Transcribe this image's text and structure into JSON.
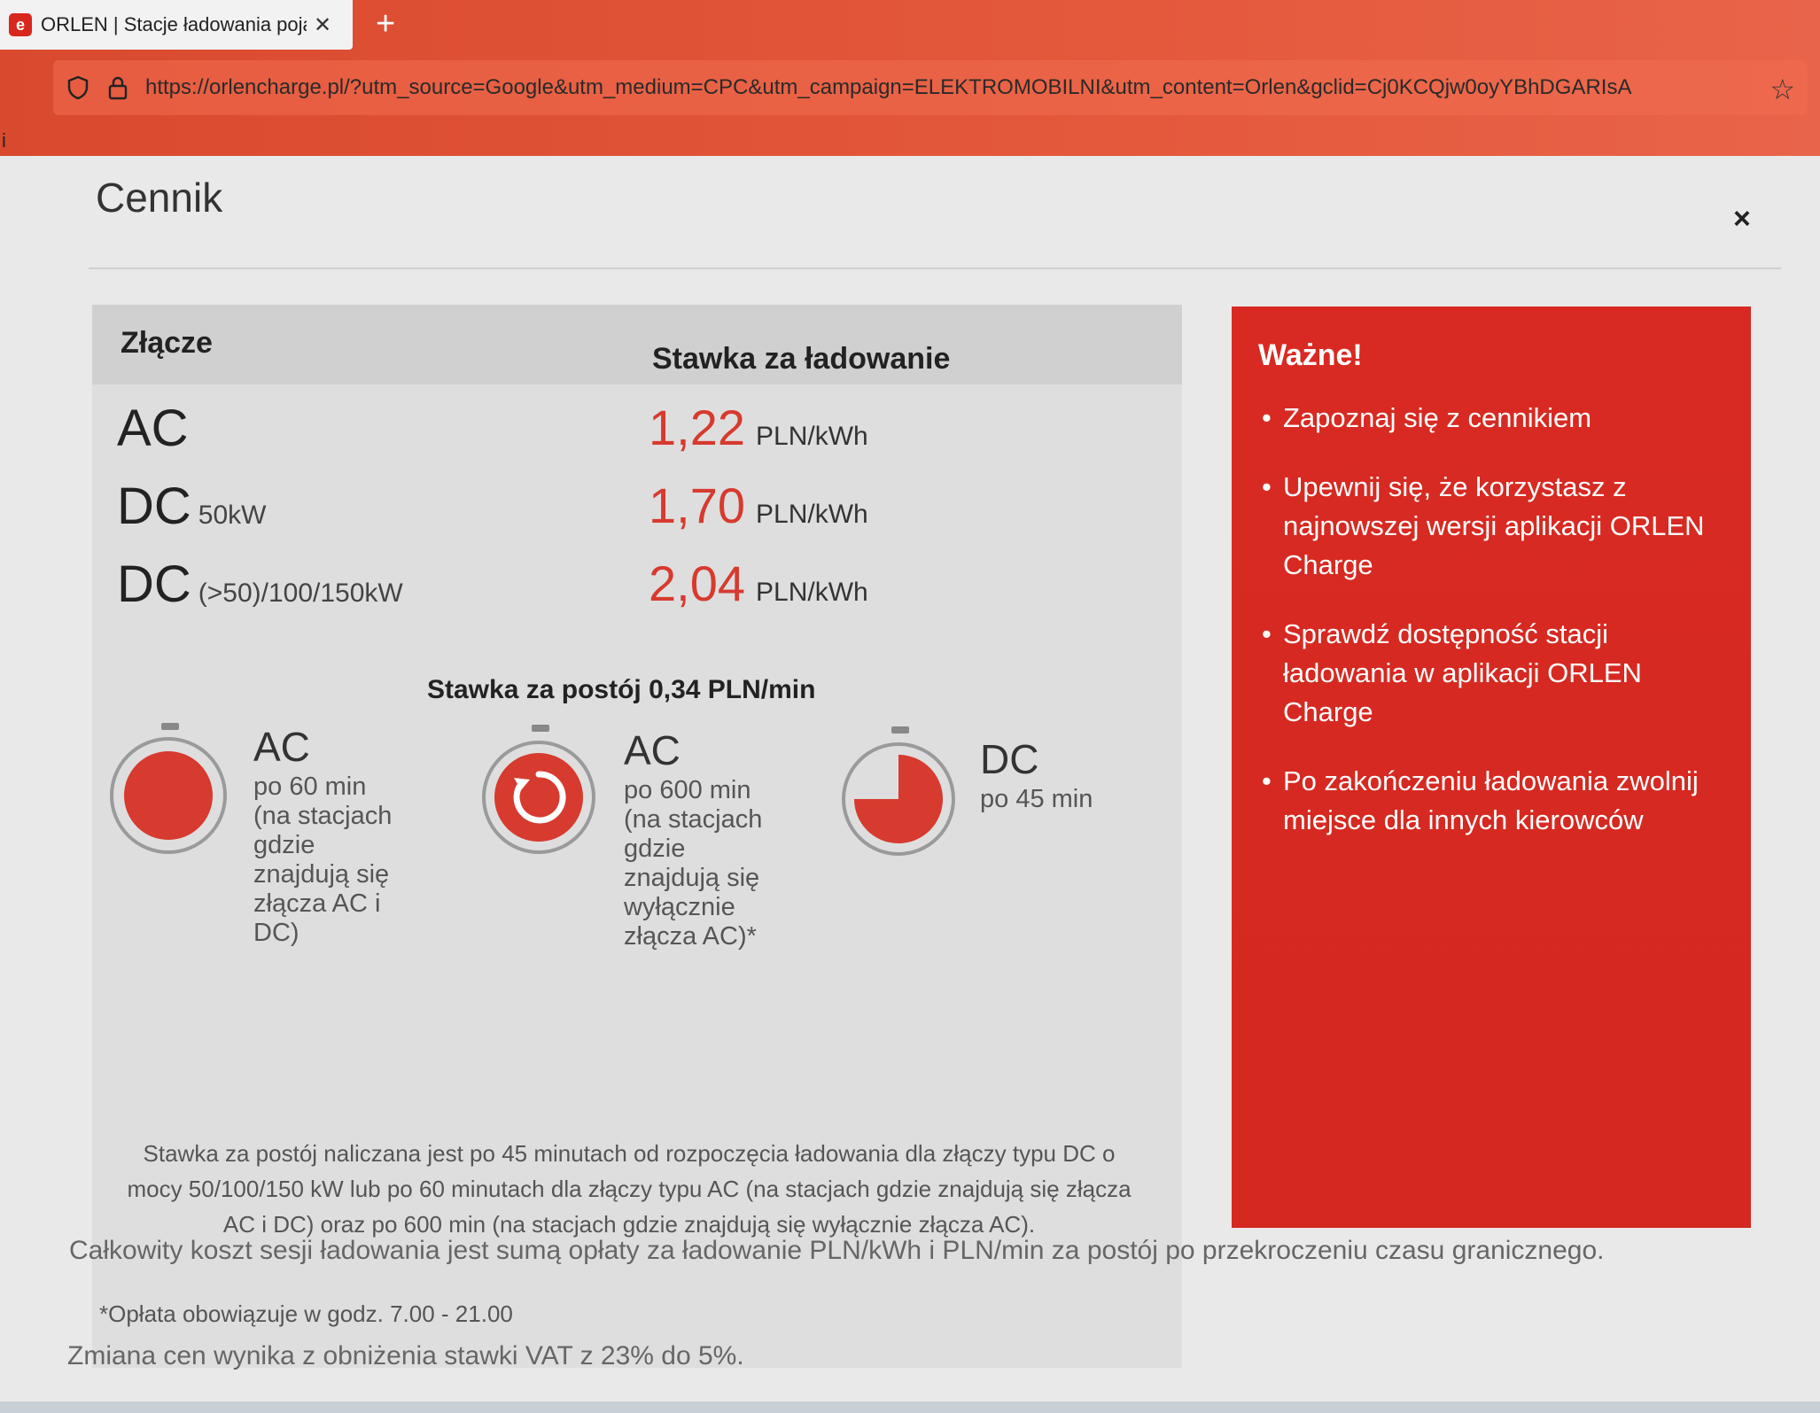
{
  "browser": {
    "tab_title": "ORLEN | Stacje ładowania pojaz",
    "tab_close": "✕",
    "new_tab": "+",
    "url": "https://orlencharge.pl/?utm_source=Google&utm_medium=CPC&utm_campaign=ELEKTROMOBILNI&utm_content=Orlen&gclid=Cj0KCQjw0oyYBhDGARIsA",
    "bookmark_letter": "i"
  },
  "modal": {
    "title": "Cennik",
    "close_label": "×"
  },
  "price_table": {
    "header_connector": "Złącze",
    "header_rate": "Stawka za ładowanie",
    "rows": [
      {
        "connector": "AC",
        "connector_sub": "",
        "price": "1,22",
        "unit": "PLN/kWh"
      },
      {
        "connector": "DC",
        "connector_sub": "50kW",
        "price": "1,70",
        "unit": "PLN/kWh"
      },
      {
        "connector": "DC",
        "connector_sub": "(>50)/100/150kW",
        "price": "2,04",
        "unit": "PLN/kWh"
      }
    ]
  },
  "idle": {
    "title": "Stawka za postój 0,34 PLN/min",
    "items": [
      {
        "type": "AC",
        "desc_lines": [
          "po 60 min",
          "(na stacjach",
          "gdzie",
          "znajdują się",
          "złącza AC i",
          "DC)"
        ]
      },
      {
        "type": "AC",
        "desc_lines": [
          "po 600 min",
          "(na stacjach",
          "gdzie",
          "znajdują się",
          "wyłącznie",
          "złącza AC)*"
        ]
      },
      {
        "type": "DC",
        "desc_lines": [
          "po 45 min"
        ]
      }
    ],
    "note": "Stawka za postój naliczana jest po 45 minutach od rozpoczęcia ładowania dla złączy typu DC o mocy 50/100/150 kW lub po 60 minutach dla złączy typu AC (na stacjach gdzie znajdują się złącza AC i DC) oraz po 600 min (na stacjach gdzie znajdują się wyłącznie złącza AC).",
    "footnote": "*Opłata obowiązuje w godz. 7.00 - 21.00"
  },
  "important": {
    "title": "Ważne!",
    "items": [
      "Zapoznaj się z cennikiem",
      "Upewnij się, że korzystasz z najnowszej wersji aplikacji ORLEN Charge",
      "Sprawdź dostępność stacji ładowania w aplikacji ORLEN Charge",
      "Po zakończeniu ładowania zwolnij miejsce dla innych kierowców"
    ]
  },
  "summary": "Całkowity koszt sesji ładowania jest sumą opłaty za ładowanie PLN/kWh i PLN/min za postój po przekroczeniu czasu granicznego.",
  "vat_note": "Zmiana cen wynika z obniżenia stawki VAT z 23% do 5%.",
  "colors": {
    "accent_red": "#d82a22",
    "price_red": "#d73a2e"
  },
  "icons": [
    "stopwatch-full-icon",
    "stopwatch-restart-icon",
    "stopwatch-three-quarter-icon",
    "shield-icon",
    "lock-icon",
    "star-icon",
    "orlen-favicon-icon"
  ]
}
